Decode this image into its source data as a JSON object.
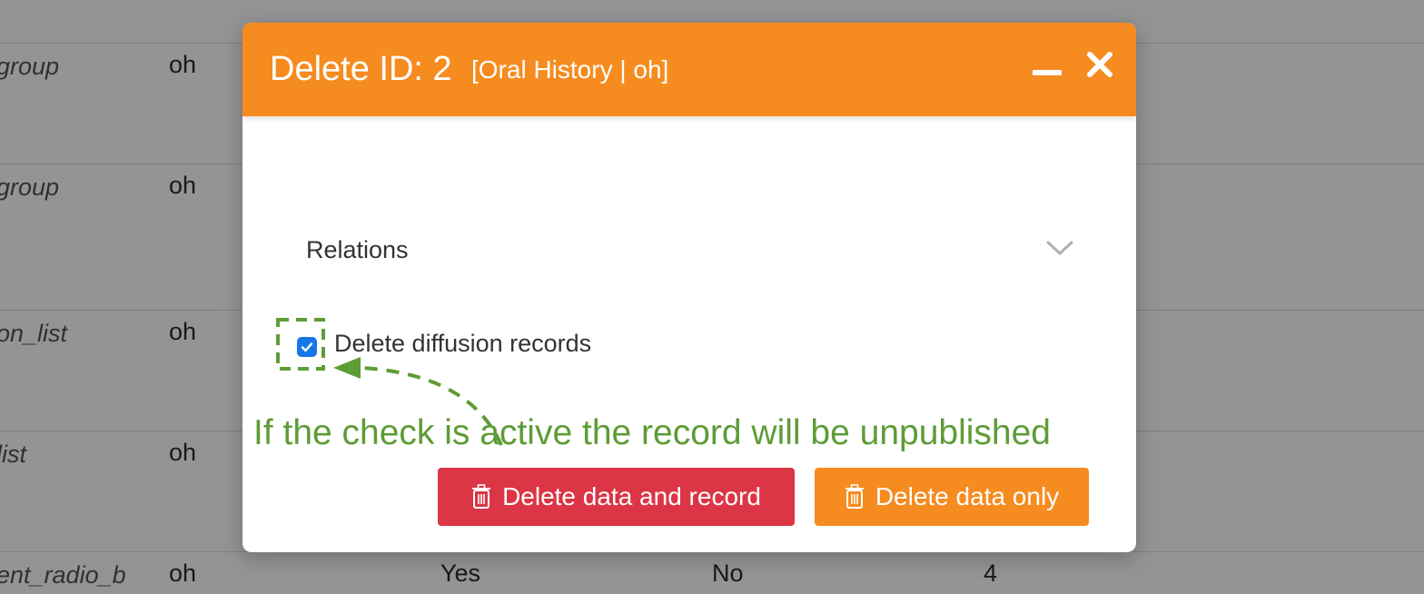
{
  "background_table": {
    "rows": [
      {
        "name": "group",
        "value": "oh"
      },
      {
        "name": "group",
        "value": "oh"
      },
      {
        "name": "on_list",
        "value": "oh"
      },
      {
        "name": "list",
        "value": "oh"
      },
      {
        "name": "ent_radio_b",
        "value": "oh",
        "col3": "Yes",
        "col4": "No",
        "col5": "4"
      }
    ]
  },
  "modal": {
    "title": "Delete ID: 2",
    "subtitle": "[Oral History | oh]",
    "relations_label": "Relations",
    "checkbox_label": "Delete diffusion records",
    "checkbox_checked": true,
    "annotation": "If the check is active the record will be unpublished",
    "buttons": {
      "delete_data_and_record": "Delete data and record",
      "delete_data_only": "Delete data only"
    },
    "icons": {
      "minimize": "minimize-icon",
      "close": "close-icon",
      "chevron": "chevron-down-icon",
      "trash": "trash-icon"
    }
  },
  "colors": {
    "header": "#f68b1f",
    "danger": "#dc3545",
    "warning": "#f68b1f",
    "checkbox": "#1677e8",
    "annotation": "#5e9c36"
  }
}
